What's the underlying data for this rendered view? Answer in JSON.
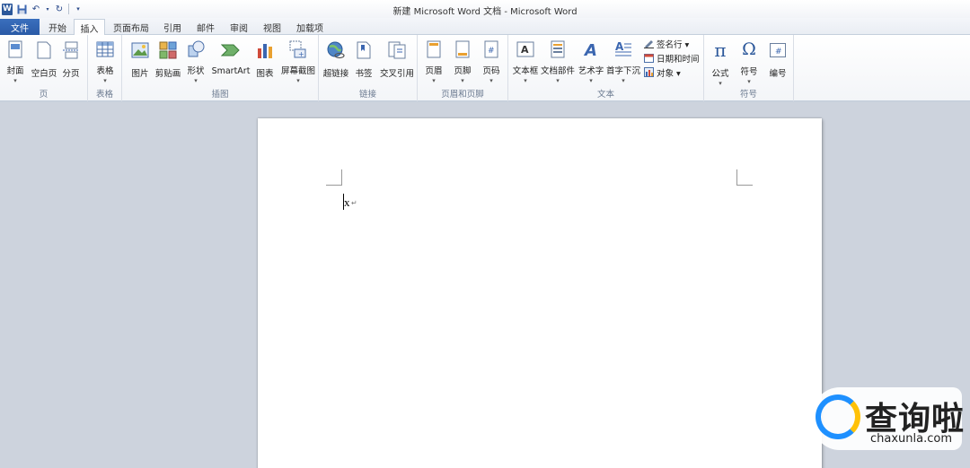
{
  "window": {
    "title": "新建 Microsoft Word 文档 - Microsoft Word",
    "app_icon": "W"
  },
  "qat": {
    "save_icon": "save-icon",
    "undo_icon": "undo-icon",
    "redo_icon": "redo-icon",
    "customize_icon": "customize-icon"
  },
  "tabs": [
    {
      "label": "文件"
    },
    {
      "label": "开始"
    },
    {
      "label": "插入"
    },
    {
      "label": "页面布局"
    },
    {
      "label": "引用"
    },
    {
      "label": "邮件"
    },
    {
      "label": "审阅"
    },
    {
      "label": "视图"
    },
    {
      "label": "加载项"
    }
  ],
  "active_tab": "插入",
  "ribbon": {
    "pages": {
      "label": "页",
      "items": [
        {
          "label": "封面"
        },
        {
          "label": "空白页"
        },
        {
          "label": "分页"
        }
      ]
    },
    "tables": {
      "label": "表格",
      "items": [
        {
          "label": "表格"
        }
      ]
    },
    "illustrations": {
      "label": "插图",
      "items": [
        {
          "label": "图片"
        },
        {
          "label": "剪贴画"
        },
        {
          "label": "形状"
        },
        {
          "label": "SmartArt"
        },
        {
          "label": "图表"
        },
        {
          "label": "屏幕截图"
        }
      ]
    },
    "links": {
      "label": "链接",
      "items": [
        {
          "label": "超链接"
        },
        {
          "label": "书签"
        },
        {
          "label": "交叉引用"
        }
      ]
    },
    "header_footer": {
      "label": "页眉和页脚",
      "items": [
        {
          "label": "页眉"
        },
        {
          "label": "页脚"
        },
        {
          "label": "页码"
        }
      ]
    },
    "text": {
      "label": "文本",
      "items": [
        {
          "label": "文本框"
        },
        {
          "label": "文档部件"
        },
        {
          "label": "艺术字"
        },
        {
          "label": "首字下沉"
        }
      ],
      "small_items": [
        {
          "label": "签名行 ▾"
        },
        {
          "label": "日期和时间"
        },
        {
          "label": "对象 ▾"
        }
      ]
    },
    "symbols": {
      "label": "符号",
      "items": [
        {
          "label": "公式"
        },
        {
          "label": "符号"
        },
        {
          "label": "编号"
        }
      ]
    }
  },
  "document": {
    "text": "x",
    "para_mark": "↵"
  },
  "watermark": {
    "cn": "查询啦",
    "en": "chaxunla.com"
  },
  "colors": {
    "file_tab": "#2a5aa6",
    "accent": "#2b579a",
    "doc_bg": "#cdd3dd"
  }
}
